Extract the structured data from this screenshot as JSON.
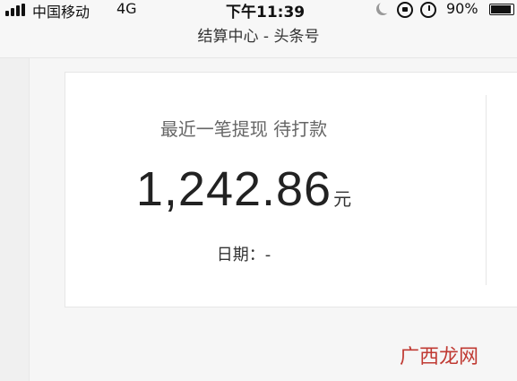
{
  "status_bar": {
    "carrier": "中国移动",
    "network": "4G",
    "time": "下午11:39",
    "battery_percent": "90%",
    "battery_level": 0.9,
    "icons": [
      "signal-icon",
      "moon-icon",
      "lock-rotation-icon",
      "alarm-icon",
      "battery-icon"
    ]
  },
  "header": {
    "title": "结算中心 - 头条号"
  },
  "withdraw_card": {
    "status_text": "最近一笔提现 待打款",
    "amount": "1,242.86",
    "unit": "元",
    "date_label": "日期：",
    "date_value": "-"
  },
  "watermark": {
    "text": "广西龙网"
  },
  "colors": {
    "background": "#f6f6f6",
    "card": "#ffffff",
    "watermark": "#c03a33"
  }
}
